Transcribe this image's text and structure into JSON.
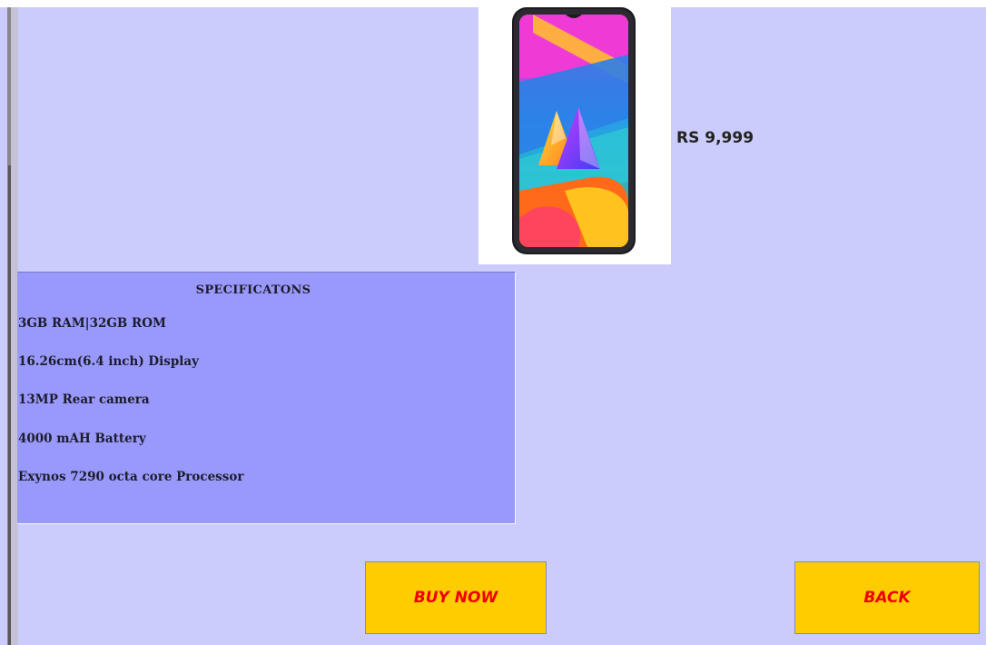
{
  "product": {
    "image_icon": "smartphone-icon",
    "price": "RS 9,999"
  },
  "specifications": {
    "title": "SPECIFICATONS",
    "items": [
      "3GB RAM|32GB ROM",
      "16.26cm(6.4 inch) Display",
      "13MP Rear camera",
      "4000 mAH Battery",
      "Exynos 7290 octa core Processor"
    ]
  },
  "actions": {
    "buy_label": "BUY NOW",
    "back_label": "BACK"
  },
  "colors": {
    "background": "#ccccfc",
    "spec_panel": "#9999fc",
    "button_fill": "#ffcc00",
    "button_text": "#ee0000"
  }
}
